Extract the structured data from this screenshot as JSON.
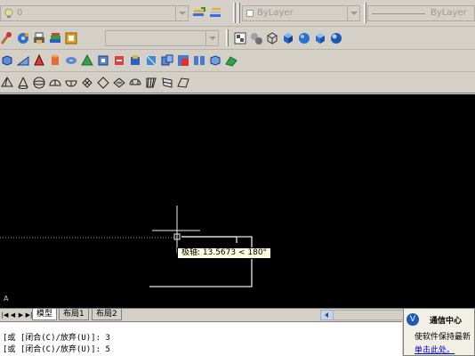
{
  "toolbar": {
    "layer_value": "0",
    "color_value": "ByLayer",
    "linetype_value": "ByLayer"
  },
  "icons": {
    "row1_layer": [
      "layer-manager-icon",
      "layer-previous-icon"
    ],
    "row2_left": [
      "paintbrush-icon",
      "disc-icon",
      "print-icon",
      "layers-icon",
      "match-props-icon"
    ],
    "row2_right": [
      "render-setup-icon",
      "lights-icon",
      "wire-cube-icon",
      "shaded-cube-icon",
      "sphere-icon",
      "hidden-cube-icon",
      "blue-sphere-icon"
    ],
    "row3": [
      "box-icon",
      "wedge-icon",
      "cone-icon",
      "cylinder-icon",
      "torus-icon",
      "pyramid-icon",
      "extrude-icon",
      "revolve-icon",
      "sweep-icon",
      "loft-icon",
      "union-icon",
      "subtract-icon",
      "intersect-icon",
      "slice-icon",
      "solid-edit-icon"
    ],
    "row4": [
      "pyramid-outline-icon",
      "cone-outline-icon",
      "sphere-outline-icon",
      "dome-icon",
      "dish-icon",
      "mesh-icon",
      "planar-icon",
      "revsurf-icon",
      "tabsurf-icon",
      "rulesurf-icon",
      "edgesurf-icon",
      "3dface-icon"
    ]
  },
  "canvas": {
    "tooltip": "极轴: 13.5673 < 180°",
    "ucs_label": "A"
  },
  "tabs": {
    "model": "模型",
    "layout1": "布局1",
    "layout2": "布局2"
  },
  "command": {
    "line1": "[或  [闭合(C)/放弃(U)]: 3",
    "line2": "[或  [闭合(C)/放弃(U)]: 5"
  },
  "comm_center": {
    "title": "通信中心",
    "line1": "使软件保持最新",
    "link": "单击此处。"
  },
  "colors": {
    "canvas_bg": "#000000",
    "tooltip_bg": "#ffffe1",
    "toolbar_bg": "#d4d0c8"
  }
}
